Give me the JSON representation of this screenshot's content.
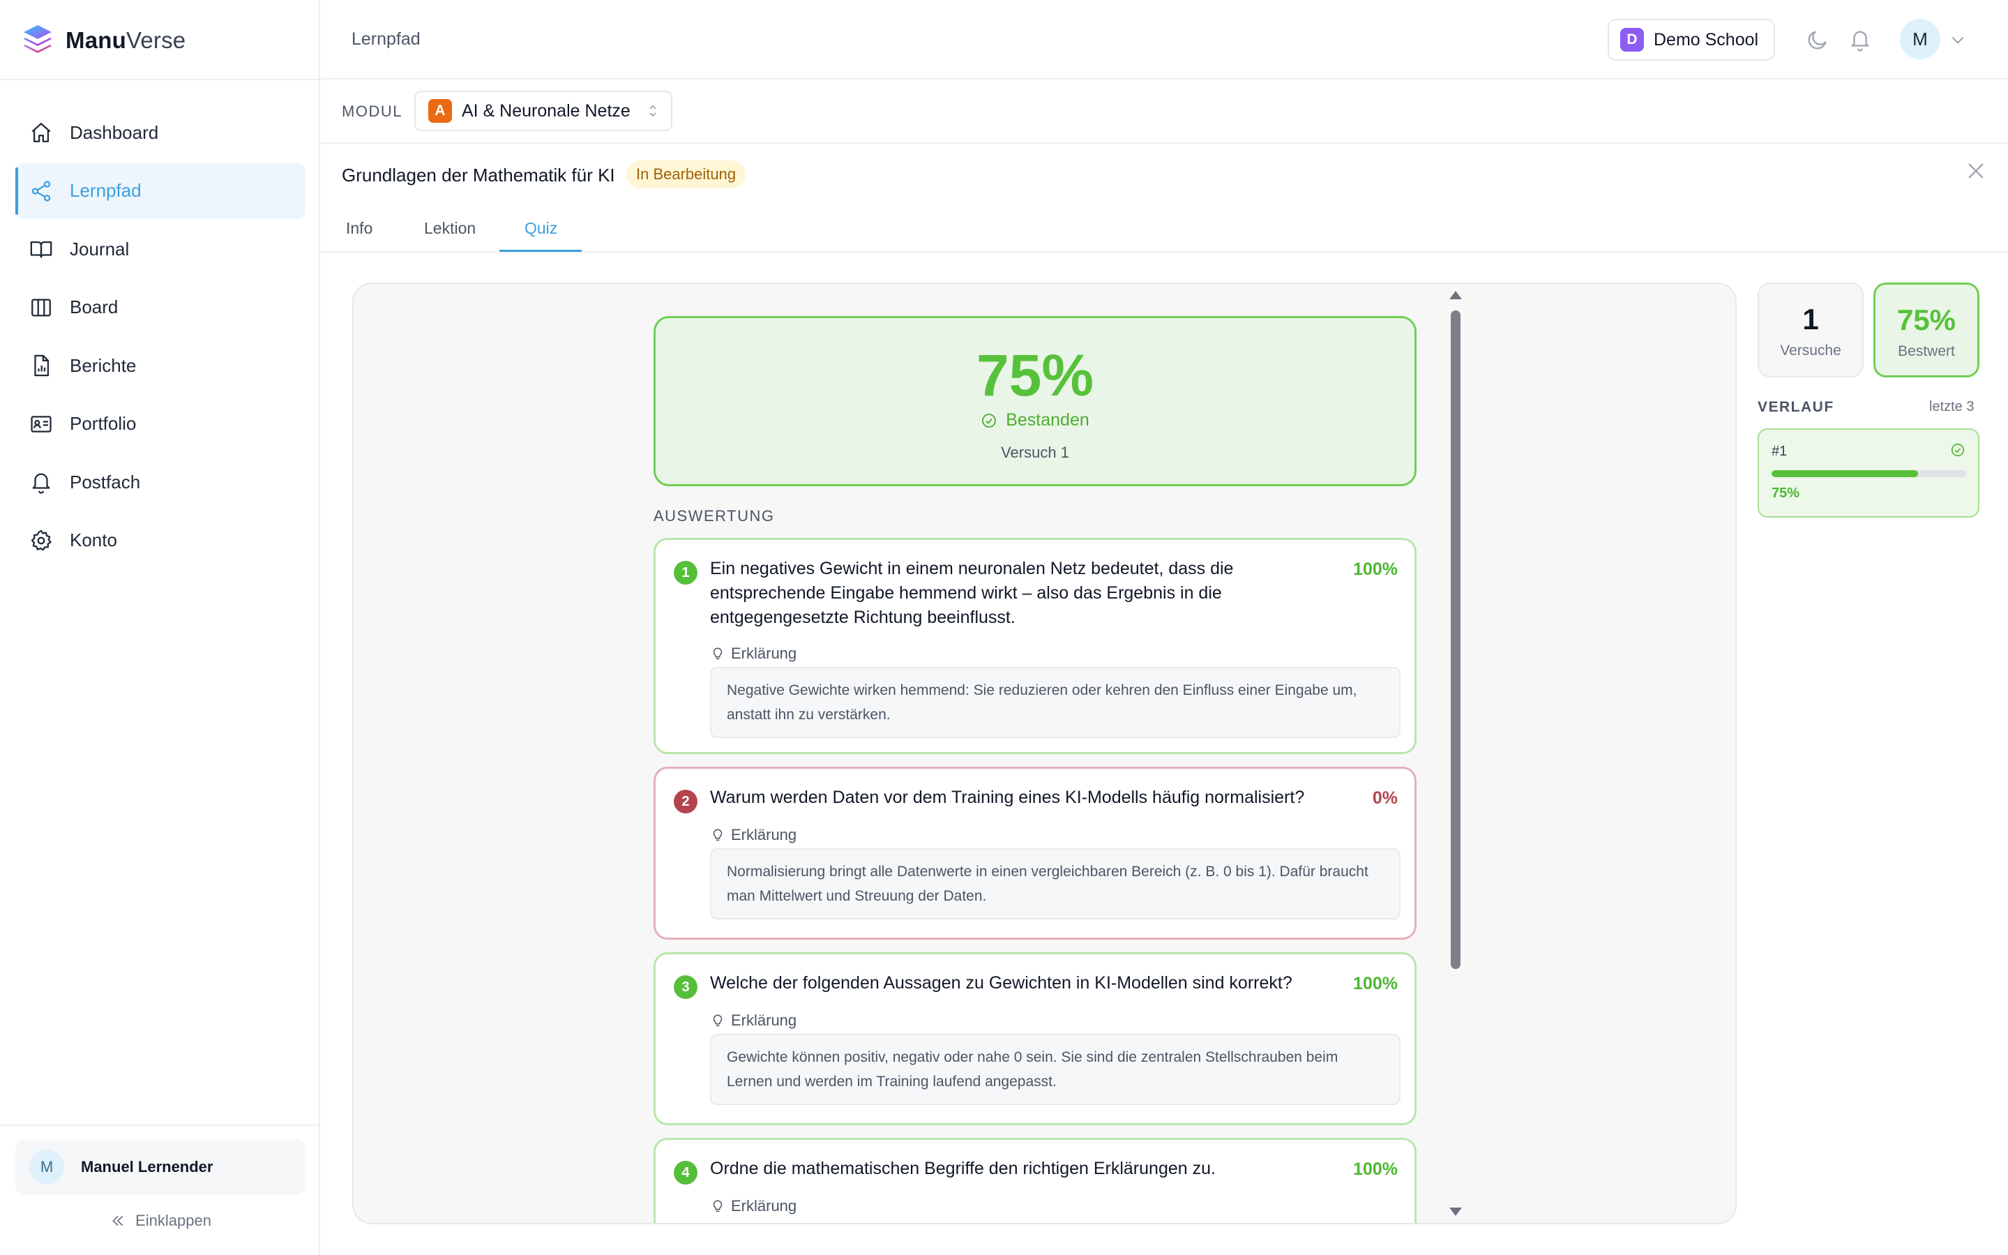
{
  "brand": {
    "bold": "Manu",
    "light": "Verse"
  },
  "sidebar": {
    "items": [
      {
        "label": "Dashboard",
        "icon": "home-icon"
      },
      {
        "label": "Lernpfad",
        "icon": "share-nodes-icon",
        "active": true
      },
      {
        "label": "Journal",
        "icon": "book-open-icon"
      },
      {
        "label": "Board",
        "icon": "columns-icon"
      },
      {
        "label": "Berichte",
        "icon": "report-file-icon"
      },
      {
        "label": "Portfolio",
        "icon": "id-card-icon"
      },
      {
        "label": "Postfach",
        "icon": "bell-icon"
      },
      {
        "label": "Konto",
        "icon": "gear-icon"
      }
    ],
    "user": {
      "initial": "M",
      "name": "Manuel Lernender"
    },
    "collapse_label": "Einklappen"
  },
  "header": {
    "breadcrumb": "Lernpfad",
    "school": {
      "initial": "D",
      "name": "Demo School",
      "badge_color": "#8b5cf6"
    },
    "avatar_initial": "M"
  },
  "module": {
    "label": "MODUL",
    "badge": "A",
    "badge_color": "#ea6a12",
    "selected": "AI & Neuronale Netze"
  },
  "lesson": {
    "title": "Grundlagen der Mathematik für KI",
    "status": "In Bearbeitung"
  },
  "tabs": [
    {
      "label": "Info"
    },
    {
      "label": "Lektion"
    },
    {
      "label": "Quiz",
      "active": true
    }
  ],
  "result": {
    "score": "75%",
    "status": "Bestanden",
    "attempt": "Versuch 1",
    "accent": "#57c13b"
  },
  "evaluation": {
    "label": "AUSWERTUNG",
    "explanation_label": "Erklärung",
    "questions": [
      {
        "num": "1",
        "text": "Ein negatives Gewicht in einem neuronalen Netz bedeutet, dass die entsprechende Eingabe hemmend wirkt – also das Ergebnis in die entgegengesetzte Richtung beeinflusst.",
        "pct": "100%",
        "explanation": "Negative Gewichte wirken hemmend: Sie reduzieren oder kehren den Einfluss einer Eingabe um, anstatt ihn zu verstärken."
      },
      {
        "num": "2",
        "text": "Warum werden Daten vor dem Training eines KI-Modells häufig normalisiert?",
        "pct": "0%",
        "explanation": "Normalisierung bringt alle Datenwerte in einen vergleichbaren Bereich (z. B. 0 bis 1). Dafür braucht man Mittelwert und Streuung der Daten."
      },
      {
        "num": "3",
        "text": "Welche der folgenden Aussagen zu Gewichten in KI-Modellen sind korrekt?",
        "pct": "100%",
        "explanation": "Gewichte können positiv, negativ oder nahe 0 sein. Sie sind die zentralen Stellschrauben beim Lernen und werden im Training laufend angepasst."
      },
      {
        "num": "4",
        "text": "Ordne die mathematischen Begriffe den richtigen Erklärungen zu.",
        "pct": "100%"
      }
    ]
  },
  "stats": {
    "attempts": {
      "value": "1",
      "label": "Versuche"
    },
    "best": {
      "value": "75%",
      "label": "Bestwert"
    }
  },
  "history": {
    "label": "VERLAUF",
    "range": "letzte 3",
    "entries": [
      {
        "id": "#1",
        "pct": "75%",
        "fraction": 0.75
      }
    ]
  }
}
